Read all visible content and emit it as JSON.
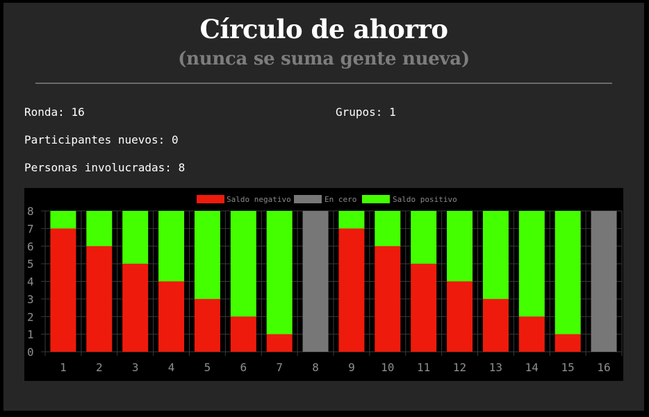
{
  "header": {
    "title": "Círculo de ahorro",
    "subtitle": "(nunca se suma gente nueva)"
  },
  "stats": {
    "ronda_label": "Ronda:",
    "ronda_value": "16",
    "grupos_label": "Grupos:",
    "grupos_value": "1",
    "nuevos_label": "Participantes nuevos:",
    "nuevos_value": "0",
    "involucradas_label": "Personas involucradas:",
    "involucradas_value": "8"
  },
  "chart_data": {
    "type": "bar",
    "stacked": true,
    "categories": [
      "1",
      "2",
      "3",
      "4",
      "5",
      "6",
      "7",
      "8",
      "9",
      "10",
      "11",
      "12",
      "13",
      "14",
      "15",
      "16"
    ],
    "series": [
      {
        "name": "Saldo negativo",
        "color": "#ee1b0c",
        "values": [
          7,
          6,
          5,
          4,
          3,
          2,
          1,
          0,
          7,
          6,
          5,
          4,
          3,
          2,
          1,
          0
        ]
      },
      {
        "name": "En cero",
        "color": "#777777",
        "values": [
          0,
          0,
          0,
          0,
          0,
          0,
          0,
          8,
          0,
          0,
          0,
          0,
          0,
          0,
          0,
          8
        ]
      },
      {
        "name": "Saldo positivo",
        "color": "#44ff00",
        "values": [
          1,
          2,
          3,
          4,
          5,
          6,
          7,
          0,
          1,
          2,
          3,
          4,
          5,
          6,
          7,
          0
        ]
      }
    ],
    "ylim": [
      0,
      8
    ],
    "yticks": [
      "0",
      "1",
      "2",
      "3",
      "4",
      "5",
      "6",
      "7",
      "8"
    ],
    "grid": true,
    "legend": "top-center",
    "xlabel": "",
    "ylabel": ""
  }
}
